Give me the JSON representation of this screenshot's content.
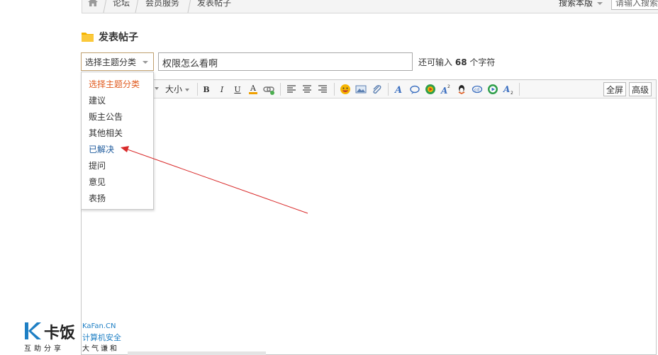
{
  "breadcrumb": {
    "items": [
      "论坛",
      "会员服务",
      "发表帖子"
    ]
  },
  "top_search": {
    "scope_label": "搜索本版",
    "placeholder": "请输入搜索"
  },
  "page_title": "发表帖子",
  "subject_row": {
    "category_selected": "选择主题分类",
    "subject_value": "权限怎么看啊",
    "char_hint_prefix": "还可输入",
    "char_hint_count": "68",
    "char_hint_suffix": "个字符"
  },
  "category_dropdown": {
    "items": [
      "选择主题分类",
      "建议",
      "贩主公告",
      "其他相关",
      "已解决",
      "提问",
      "意见",
      "表扬"
    ],
    "highlighted": "已解决"
  },
  "toolbar": {
    "size_label": "大小",
    "bold": "B",
    "italic": "I",
    "underline": "U",
    "font_color": "A",
    "fullscreen_label": "全屏",
    "advanced_label": "高级"
  },
  "watermark": {
    "brand": "卡饭",
    "tagline": "互助分享",
    "site": "KaFan.CN",
    "slogan1": "计算机安全",
    "slogan2": "大气谦和"
  },
  "colors": {
    "accent_orange": "#e05a1e",
    "link_blue": "#1d5a9c",
    "arrow_red": "#d92b2b",
    "folder_yellow": "#f5b400"
  }
}
